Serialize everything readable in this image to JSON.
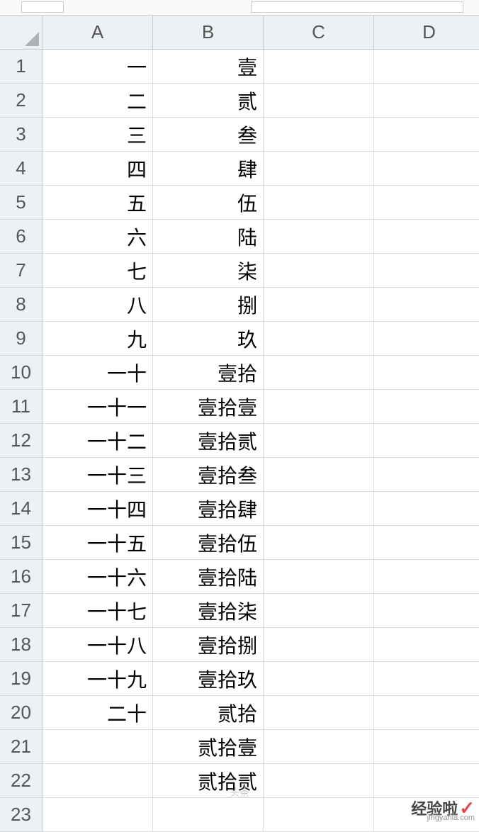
{
  "columns": [
    "A",
    "B",
    "C",
    "D"
  ],
  "rowCount": 23,
  "cells": {
    "A": [
      "一",
      "二",
      "三",
      "四",
      "五",
      "六",
      "七",
      "八",
      "九",
      "一十",
      "一十一",
      "一十二",
      "一十三",
      "一十四",
      "一十五",
      "一十六",
      "一十七",
      "一十八",
      "一十九",
      "二十",
      "",
      "",
      ""
    ],
    "B": [
      "壹",
      "贰",
      "叁",
      "肆",
      "伍",
      "陆",
      "柒",
      "捌",
      "玖",
      "壹拾",
      "壹拾壹",
      "壹拾贰",
      "壹拾叁",
      "壹拾肆",
      "壹拾伍",
      "壹拾陆",
      "壹拾柒",
      "壹拾捌",
      "壹拾玖",
      "贰拾",
      "贰拾壹",
      "贰拾贰",
      ""
    ],
    "C": [
      "",
      "",
      "",
      "",
      "",
      "",
      "",
      "",
      "",
      "",
      "",
      "",
      "",
      "",
      "",
      "",
      "",
      "",
      "",
      "",
      "",
      "",
      ""
    ],
    "D": [
      "",
      "",
      "",
      "",
      "",
      "",
      "",
      "",
      "",
      "",
      "",
      "",
      "",
      "",
      "",
      "",
      "",
      "",
      "",
      "",
      "",
      "",
      ""
    ]
  },
  "watermark": {
    "main": "经验啦",
    "sub": "jingyanla.com"
  },
  "faint": "头条"
}
